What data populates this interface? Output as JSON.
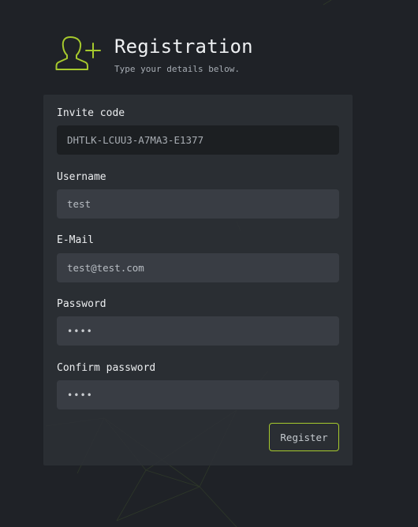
{
  "header": {
    "icon": "user-add-icon",
    "title": "Registration",
    "subtitle": "Type your details below."
  },
  "form": {
    "invite_code": {
      "label": "Invite code",
      "value": "DHTLK-LCUU3-A7MA3-E1377"
    },
    "username": {
      "label": "Username",
      "value": "test"
    },
    "email": {
      "label": "E-Mail",
      "value": "test@test.com"
    },
    "password": {
      "label": "Password",
      "value": "test"
    },
    "confirm_password": {
      "label": "Confirm password",
      "value": "test"
    },
    "register_label": "Register"
  },
  "colors": {
    "background": "#1f2227",
    "panel": "#2c3036",
    "input": "#393d44",
    "input_readonly": "#1c1f22",
    "accent": "#a6c92d"
  }
}
